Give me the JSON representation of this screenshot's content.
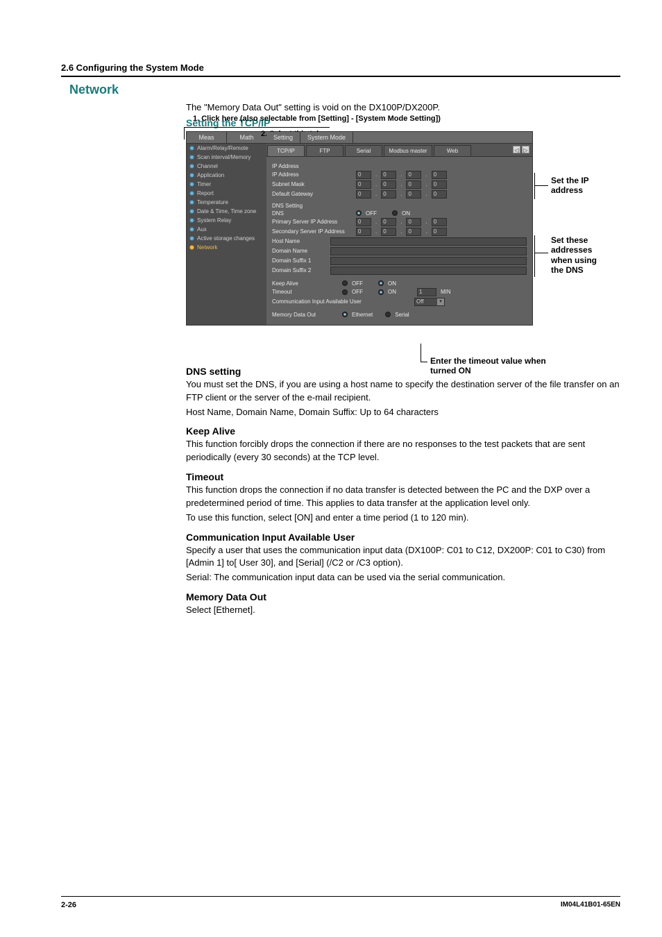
{
  "header": {
    "section": "2.6  Configuring the System Mode"
  },
  "title": "Network",
  "intro": "The \"Memory Data Out\" setting is void on the DX100P/DX200P.",
  "setting_heading": "Setting the TCP/IP",
  "callouts": {
    "c1": "1. Click here (also selectable from [Setting] - [System Mode Setting])",
    "c2": "2. Select this tab",
    "right1_l1": "Set the IP",
    "right1_l2": "address",
    "right2_l1": "Set these",
    "right2_l2": "addresses",
    "right2_l3": "when using",
    "right2_l4": "the DNS",
    "bottom_l1": "Enter the timeout value when",
    "bottom_l2": "turned ON"
  },
  "app": {
    "sidebar_tabs": {
      "meas": "Meas",
      "math": "Math"
    },
    "sidebar_items": [
      "Alarm/Relay/Remote",
      "Scan interval/Memory",
      "Channel",
      "Application",
      "Timer",
      "Report",
      "Temperature",
      "Date & Time, Time zone",
      "System Relay",
      "Aux",
      "Active storage changes",
      "Network"
    ],
    "main_tabs": {
      "setting": "Setting",
      "system_mode": "System Mode"
    },
    "sub_tabs": {
      "tcpip": "TCP/IP",
      "ftp": "FTP",
      "serial": "Serial",
      "modbus": "Modbus master",
      "web": "Web"
    },
    "groups": {
      "ip_address_title": "IP Address",
      "ip_address": "IP Address",
      "subnet_mask": "Subnet Mask",
      "default_gateway": "Default Gateway",
      "dns_setting_title": "DNS Setting",
      "dns": "DNS",
      "primary": "Primary Server IP Address",
      "secondary": "Secondary Server IP Address",
      "host_name": "Host Name",
      "domain_name": "Domain Name",
      "suffix1": "Domain Suffix 1",
      "suffix2": "Domain Suffix 2",
      "keep_alive": "Keep Alive",
      "timeout": "Timeout",
      "comm_user": "Communication Input Available User",
      "memory_data_out": "Memory Data Out"
    },
    "values": {
      "ip_octet": "0",
      "off": "OFF",
      "on": "ON",
      "timeout_val": "1",
      "timeout_unit": "MIN",
      "comm_user_val": "Off",
      "ethernet": "Ethernet",
      "serial": "Serial"
    }
  },
  "sections": {
    "dns_h": "DNS setting",
    "dns_p1": "You must set the DNS, if you are using a host name to specify the destination server of the file transfer on an FTP client or the server of the e-mail recipient.",
    "dns_p2": "Host Name, Domain Name, Domain Suffix: Up to 64 characters",
    "keep_h": "Keep Alive",
    "keep_p": "This function forcibly drops the connection if there are no responses to the test packets that are sent periodically (every 30 seconds) at the TCP level.",
    "timeout_h": "Timeout",
    "timeout_p1": "This function drops the connection if no data transfer is detected between the PC and the DXP over a predetermined period of time. This applies to data transfer at the application level only.",
    "timeout_p2": "To use this function, select [ON] and enter a time period (1 to 120 min).",
    "comm_h": "Communication Input Available User",
    "comm_p1": "Specify a user that uses the communication input data (DX100P: C01 to C12, DX200P: C01 to C30) from [Admin 1] to[ User 30], and [Serial] (/C2 or /C3 option).",
    "comm_p2": "Serial: The communication input data can be used via the serial communication.",
    "mem_h": "Memory Data Out",
    "mem_p": "Select [Ethernet]."
  },
  "footer": {
    "page": "2-26",
    "doc": "IM04L41B01-65EN"
  }
}
